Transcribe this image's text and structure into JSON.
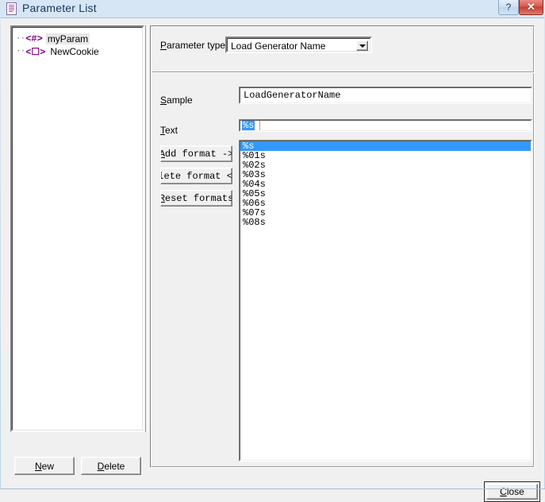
{
  "window": {
    "title": "Parameter List",
    "icon": "document-list-icon",
    "help_button": "?",
    "close_button": "✕"
  },
  "tree": {
    "items": [
      {
        "icon_text": "<#>",
        "label": "myParam",
        "selected": true
      },
      {
        "icon_text": "<☐>",
        "label": "NewCookie",
        "selected": false
      }
    ]
  },
  "left_buttons": {
    "new": {
      "accel": "N",
      "before": "",
      "after": "ew"
    },
    "delete": {
      "accel": "D",
      "before": "",
      "after": "elete"
    }
  },
  "parameter_type": {
    "label_before": "",
    "label_accel": "P",
    "label_after": "arameter type:",
    "value": "Load Generator Name",
    "caret_icon": "chevron-down-icon"
  },
  "sample": {
    "label_before": "",
    "label_accel": "S",
    "label_after": "ample",
    "value": "LoadGeneratorName"
  },
  "text": {
    "label_before": "",
    "label_accel": "T",
    "label_after": "ext",
    "input_value": "%s"
  },
  "format_buttons": [
    {
      "name": "add-format-button",
      "accel": "A",
      "before": "",
      "after": "dd format ->"
    },
    {
      "name": "delete-format-button",
      "accel": "e",
      "before": "",
      "after": "lete format <"
    },
    {
      "name": "reset-format-button",
      "accel": "R",
      "before": "",
      "after": "eset formats"
    }
  ],
  "format_list": {
    "items": [
      "%s",
      "%01s",
      "%02s",
      "%03s",
      "%04s",
      "%05s",
      "%06s",
      "%07s",
      "%08s"
    ],
    "selected_index": 0
  },
  "dialog_buttons": {
    "close": {
      "accel": "C",
      "before": "",
      "after": "lose"
    }
  },
  "colors": {
    "selection": "#3399ff",
    "titlebar_text": "#17365d",
    "tree_icon": "#800080",
    "close_button": "#c63d31",
    "dialog_face": "#f0f0f0"
  }
}
